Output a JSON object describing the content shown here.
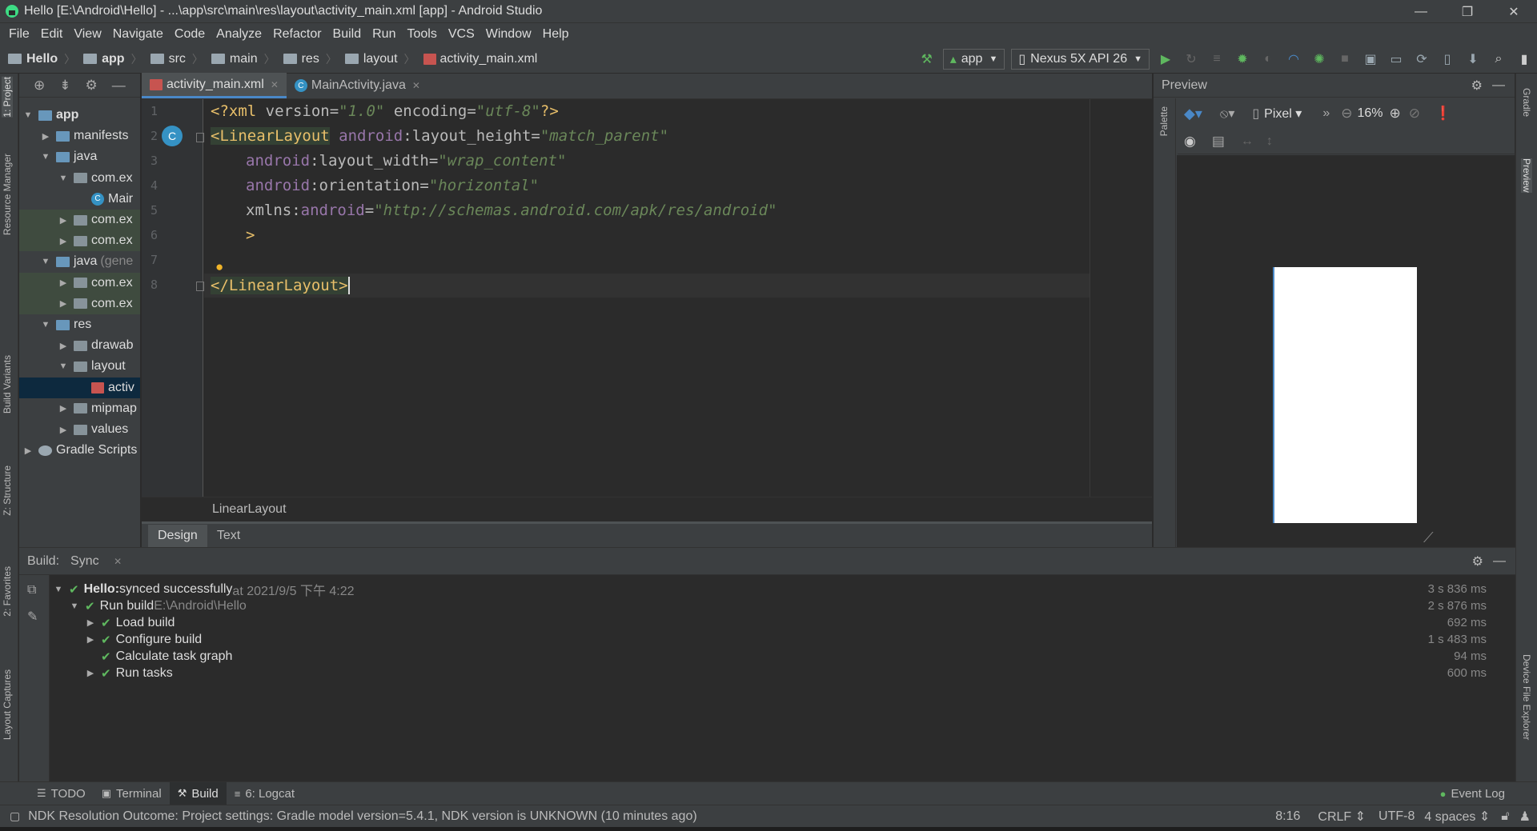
{
  "window": {
    "title": "Hello [E:\\Android\\Hello] - ...\\app\\src\\main\\res\\layout\\activity_main.xml [app] - Android Studio",
    "minimize": "—",
    "restore": "❐",
    "close": "✕"
  },
  "menu": [
    "File",
    "Edit",
    "View",
    "Navigate",
    "Code",
    "Analyze",
    "Refactor",
    "Build",
    "Run",
    "Tools",
    "VCS",
    "Window",
    "Help"
  ],
  "nav": {
    "crumbs": [
      "Hello",
      "app",
      "src",
      "main",
      "res",
      "layout",
      "activity_main.xml"
    ],
    "run_config": "app",
    "device": "Nexus 5X API 26"
  },
  "left_strip": [
    "1: Project",
    "Resource Manager",
    "Build Variants",
    "Z: Structure",
    "2: Favorites",
    "Layout Captures"
  ],
  "right_strip": [
    "Gradle",
    "Preview",
    "Device File Explorer"
  ],
  "project_tree": [
    {
      "label": "app",
      "depth": 0,
      "expanded": true,
      "icon": "folder-module-icon",
      "bold": true
    },
    {
      "label": "manifests",
      "depth": 1,
      "expanded": false,
      "icon": "folder-icon"
    },
    {
      "label": "java",
      "depth": 1,
      "expanded": true,
      "icon": "folder-icon"
    },
    {
      "label": "com.ex",
      "depth": 2,
      "expanded": true,
      "icon": "package-icon"
    },
    {
      "label": "Mair",
      "depth": 3,
      "icon": "class-icon"
    },
    {
      "label": "com.ex",
      "depth": 2,
      "expanded": false,
      "icon": "package-icon"
    },
    {
      "label": "com.ex",
      "depth": 2,
      "expanded": false,
      "icon": "package-icon"
    },
    {
      "label": "java",
      "suffix": "(gene",
      "depth": 1,
      "expanded": true,
      "icon": "folder-generated-icon"
    },
    {
      "label": "com.ex",
      "depth": 2,
      "expanded": false,
      "icon": "package-icon"
    },
    {
      "label": "com.ex",
      "depth": 2,
      "expanded": false,
      "icon": "package-icon"
    },
    {
      "label": "res",
      "depth": 1,
      "expanded": true,
      "icon": "folder-res-icon"
    },
    {
      "label": "drawab",
      "depth": 2,
      "expanded": false,
      "icon": "package-icon"
    },
    {
      "label": "layout",
      "depth": 2,
      "expanded": true,
      "icon": "package-icon"
    },
    {
      "label": "activ",
      "depth": 3,
      "icon": "xml-layout-icon",
      "selected": true
    },
    {
      "label": "mipmap",
      "depth": 2,
      "expanded": false,
      "icon": "package-icon"
    },
    {
      "label": "values",
      "depth": 2,
      "expanded": false,
      "icon": "package-icon"
    },
    {
      "label": "Gradle Scripts",
      "depth": 0,
      "expanded": false,
      "icon": "gradle-icon"
    }
  ],
  "editor": {
    "tabs": [
      {
        "label": "activity_main.xml",
        "active": true
      },
      {
        "label": "MainActivity.java",
        "active": false
      }
    ],
    "line_numbers": [
      "1",
      "2",
      "3",
      "4",
      "5",
      "6",
      "7",
      "8"
    ],
    "code": {
      "l1": {
        "pi_open": "<?xml ",
        "v_attr": "version",
        "eq1": "=",
        "v_val": "\"1.0\"",
        "sp": " ",
        "e_attr": "encoding",
        "eq2": "=",
        "e_val": "\"utf-8\"",
        "pi_close": "?>"
      },
      "l2": {
        "tag": "<LinearLayout",
        "ns": " android",
        "colon": ":",
        "attr": "layout_height",
        "eq": "=",
        "val": "\"match_parent\""
      },
      "l3": {
        "ns": "android",
        "colon": ":",
        "attr": "layout_width",
        "eq": "=",
        "val": "\"wrap_content\""
      },
      "l4": {
        "ns": "android",
        "colon": ":",
        "attr": "orientation",
        "eq": "=",
        "val": "\"horizontal\""
      },
      "l5": {
        "xmlns": "xmlns",
        "colon": ":",
        "ns": "android",
        "eq": "=",
        "val": "\"http://schemas.android.com/apk/res/android\""
      },
      "l6": {
        "close": ">"
      },
      "l8": {
        "tag": "</LinearLayout>"
      }
    },
    "breadcrumb": "LinearLayout",
    "design_tabs": [
      "Design",
      "Text"
    ]
  },
  "preview": {
    "title": "Preview",
    "device": "Pixel",
    "zoom": "16%",
    "palette_label": "Palette"
  },
  "build": {
    "tabs": [
      "Build:",
      "Sync"
    ],
    "rows": [
      {
        "text": "Hello:",
        "detail": " synced successfully",
        "extra": " at 2021/9/5 下午 4:22",
        "time": "3 s 836 ms"
      },
      {
        "text": "Run build",
        "extra": " E:\\Android\\Hello",
        "time": "2 s 876 ms"
      },
      {
        "text": "Load build",
        "time": "692 ms"
      },
      {
        "text": "Configure build",
        "time": "1 s 483 ms"
      },
      {
        "text": "Calculate task graph",
        "time": "94 ms"
      },
      {
        "text": "Run tasks",
        "time": "600 ms"
      }
    ]
  },
  "bottom_tools": [
    {
      "label": "TODO"
    },
    {
      "label": "Terminal"
    },
    {
      "label": "Build",
      "active": true
    },
    {
      "label": "6: Logcat"
    }
  ],
  "event_log": "Event Log",
  "status": {
    "message": "NDK Resolution Outcome: Project settings: Gradle model version=5.4.1, NDK version is UNKNOWN (10 minutes ago)",
    "position": "8:16",
    "line_sep": "CRLF",
    "encoding": "UTF-8",
    "indent": "4 spaces"
  },
  "colors": {
    "accent": "#4a88c7",
    "success": "#5fb85f",
    "tag": "#e8bf6a",
    "string": "#6a8759",
    "namespace": "#9876aa"
  }
}
